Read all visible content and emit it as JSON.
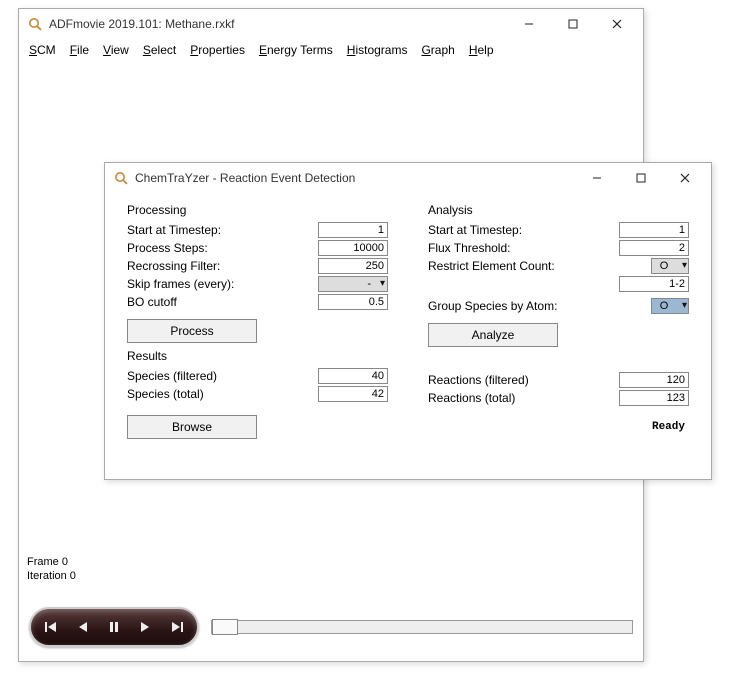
{
  "main": {
    "title": "ADFmovie 2019.101: Methane.rxkf",
    "menu": {
      "scm": "SCM",
      "file": "File",
      "view": "View",
      "select": "Select",
      "properties": "Properties",
      "energy": "Energy Terms",
      "histograms": "Histograms",
      "graph": "Graph",
      "help": "Help"
    },
    "frame_label": "Frame 0",
    "iteration_label": "Iteration 0"
  },
  "dialog": {
    "title": "ChemTraYzer - Reaction Event Detection",
    "processing": {
      "header": "Processing",
      "start_label": "Start at Timestep:",
      "start_value": "1",
      "steps_label": "Process Steps:",
      "steps_value": "10000",
      "recross_label": "Recrossing Filter:",
      "recross_value": "250",
      "skip_label": "Skip frames (every):",
      "skip_value": "-",
      "bo_label": "BO cutoff",
      "bo_value": "0.5",
      "process_btn": "Process"
    },
    "analysis": {
      "header": "Analysis",
      "start_label": "Start at Timestep:",
      "start_value": "1",
      "flux_label": "Flux Threshold:",
      "flux_value": "2",
      "restrict_label": "Restrict Element Count:",
      "restrict_elem": "O",
      "restrict_range": "1-2",
      "group_label": "Group Species by Atom:",
      "group_value": "O",
      "analyze_btn": "Analyze"
    },
    "results": {
      "header": "Results",
      "species_filtered_label": "Species (filtered)",
      "species_filtered_value": "40",
      "species_total_label": "Species (total)",
      "species_total_value": "42",
      "reactions_filtered_label": "Reactions (filtered)",
      "reactions_filtered_value": "120",
      "reactions_total_label": "Reactions (total)",
      "reactions_total_value": "123",
      "browse_btn": "Browse",
      "status": "Ready"
    }
  }
}
